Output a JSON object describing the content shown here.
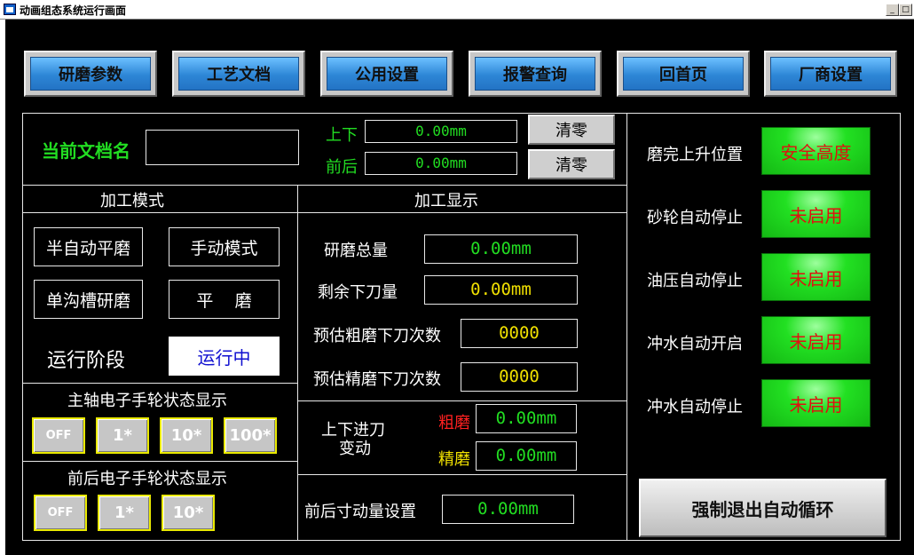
{
  "window": {
    "title": "动画组态系统运行画面",
    "btn_min": "_",
    "btn_max": "□"
  },
  "nav": [
    "研磨参数",
    "工艺文档",
    "公用设置",
    "报警查询",
    "回首页",
    "厂商设置"
  ],
  "doc": {
    "label": "当前文档名",
    "value": ""
  },
  "position": {
    "up_down_label": "上下",
    "up_down_value": "0.00mm",
    "front_back_label": "前后",
    "front_back_value": "0.00mm",
    "clear_label": "清零"
  },
  "mode": {
    "title": "加工模式",
    "buttons": [
      "半自动平磨",
      "手动模式",
      "单沟槽研磨",
      "平    磨"
    ],
    "run_stage_label": "运行阶段",
    "run_stage_value": "运行中"
  },
  "display": {
    "title": "加工显示",
    "total_label": "研磨总量",
    "total_value": "0.00mm",
    "remaining_label": "剩余下刀量",
    "remaining_value": "0.00mm",
    "rough_count_label": "预估粗磨下刀次数",
    "rough_count_value": "0000",
    "fine_count_label": "预估精磨下刀次数",
    "fine_count_value": "0000"
  },
  "feed": {
    "label_line1": "上下进刀",
    "label_line2": "变动",
    "rough_label": "粗磨",
    "rough_value": "0.00mm",
    "fine_label": "精磨",
    "fine_value": "0.00mm"
  },
  "size": {
    "label": "前后寸动量设置",
    "value": "0.00mm"
  },
  "spindle_wheel": {
    "title": "主轴电子手轮状态显示",
    "buttons": [
      "OFF",
      "1*",
      "10*",
      "100*"
    ]
  },
  "fb_wheel": {
    "title": "前后电子手轮状态显示",
    "buttons": [
      "OFF",
      "1*",
      "10*"
    ]
  },
  "status": [
    {
      "label": "磨完上升位置",
      "value": "安全高度"
    },
    {
      "label": "砂轮自动停止",
      "value": "未启用"
    },
    {
      "label": "油压自动停止",
      "value": "未启用"
    },
    {
      "label": "冲水自动开启",
      "value": "未启用"
    },
    {
      "label": "冲水自动停止",
      "value": "未启用"
    }
  ],
  "exit_button": "强制退出自动循环",
  "colors": {
    "nav_blue": "#2d86d6",
    "indicator_green": "#22e022",
    "value_green": "#22dd22",
    "value_yellow": "#f0e000",
    "alert_red": "#ff2020"
  }
}
